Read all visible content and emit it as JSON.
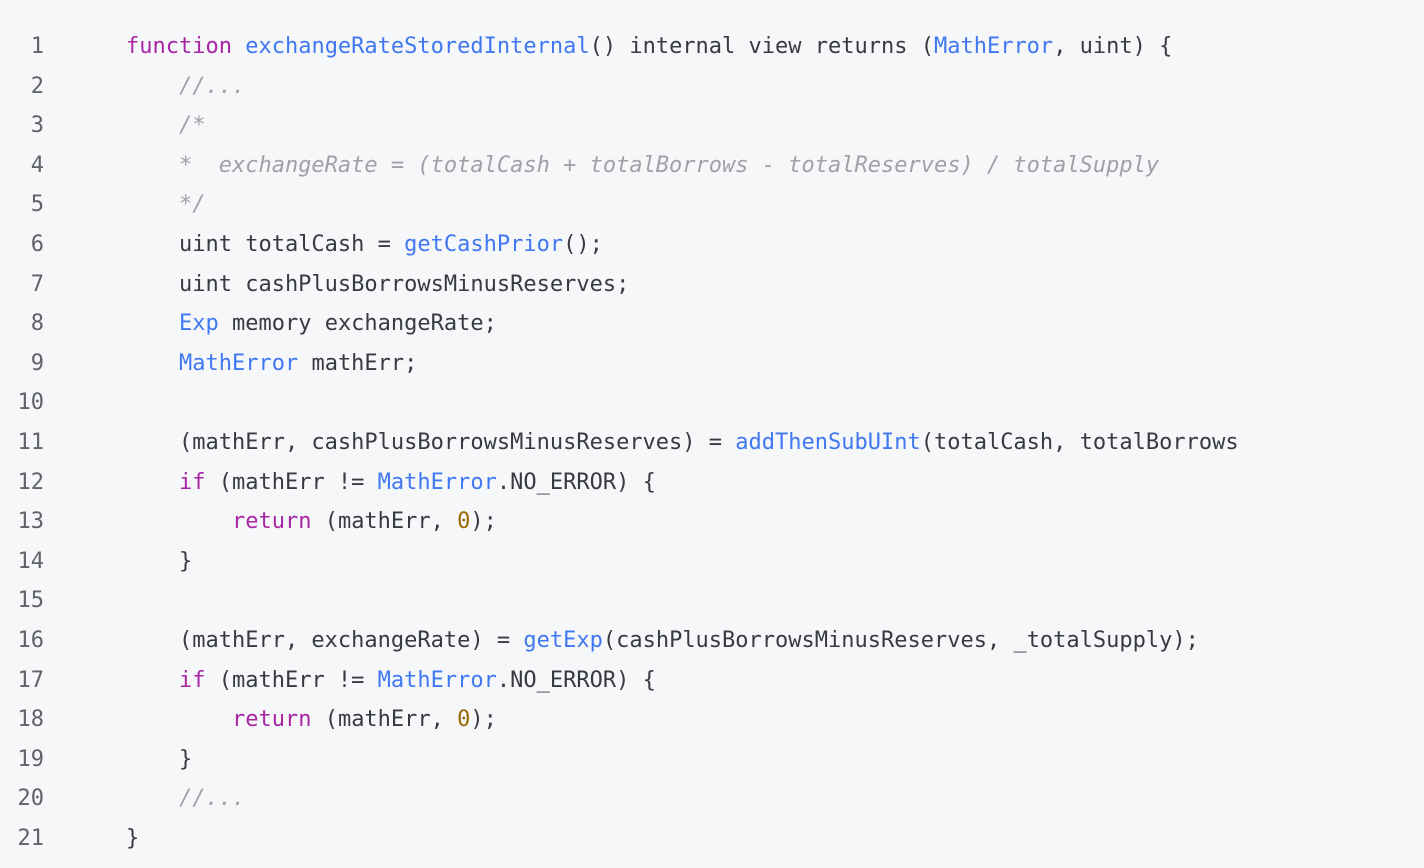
{
  "editor": {
    "language": "solidity",
    "lines": [
      {
        "n": "1",
        "tokens": [
          [
            "kw",
            "function"
          ],
          [
            "t",
            " "
          ],
          [
            "fn",
            "exchangeRateStoredInternal"
          ],
          [
            "t",
            "() internal view returns ("
          ],
          [
            "ty",
            "MathError"
          ],
          [
            "t",
            ", uint) {"
          ]
        ]
      },
      {
        "n": "2",
        "tokens": [
          [
            "t",
            "    "
          ],
          [
            "cm",
            "//..."
          ]
        ]
      },
      {
        "n": "3",
        "tokens": [
          [
            "t",
            "    "
          ],
          [
            "cm",
            "/*"
          ]
        ]
      },
      {
        "n": "4",
        "tokens": [
          [
            "t",
            "    "
          ],
          [
            "cm",
            "*  exchangeRate = (totalCash + totalBorrows - totalReserves) / totalSupply"
          ]
        ]
      },
      {
        "n": "5",
        "tokens": [
          [
            "t",
            "    "
          ],
          [
            "cm",
            "*/"
          ]
        ]
      },
      {
        "n": "6",
        "tokens": [
          [
            "t",
            "    uint totalCash = "
          ],
          [
            "fn",
            "getCashPrior"
          ],
          [
            "t",
            "();"
          ]
        ]
      },
      {
        "n": "7",
        "tokens": [
          [
            "t",
            "    uint cashPlusBorrowsMinusReserves;"
          ]
        ]
      },
      {
        "n": "8",
        "tokens": [
          [
            "t",
            "    "
          ],
          [
            "ty",
            "Exp"
          ],
          [
            "t",
            " memory exchangeRate;"
          ]
        ]
      },
      {
        "n": "9",
        "tokens": [
          [
            "t",
            "    "
          ],
          [
            "ty",
            "MathError"
          ],
          [
            "t",
            " mathErr;"
          ]
        ]
      },
      {
        "n": "10",
        "tokens": []
      },
      {
        "n": "11",
        "tokens": [
          [
            "t",
            "    (mathErr, cashPlusBorrowsMinusReserves) = "
          ],
          [
            "fn",
            "addThenSubUInt"
          ],
          [
            "t",
            "(totalCash, totalBorrows"
          ]
        ]
      },
      {
        "n": "12",
        "tokens": [
          [
            "t",
            "    "
          ],
          [
            "kw",
            "if"
          ],
          [
            "t",
            " (mathErr != "
          ],
          [
            "ty",
            "MathError"
          ],
          [
            "t",
            ".NO_ERROR) {"
          ]
        ]
      },
      {
        "n": "13",
        "tokens": [
          [
            "t",
            "        "
          ],
          [
            "kw",
            "return"
          ],
          [
            "t",
            " (mathErr, "
          ],
          [
            "num",
            "0"
          ],
          [
            "t",
            ");"
          ]
        ]
      },
      {
        "n": "14",
        "tokens": [
          [
            "t",
            "    }"
          ]
        ]
      },
      {
        "n": "15",
        "tokens": []
      },
      {
        "n": "16",
        "tokens": [
          [
            "t",
            "    (mathErr, exchangeRate) = "
          ],
          [
            "fn",
            "getExp"
          ],
          [
            "t",
            "(cashPlusBorrowsMinusReserves, _totalSupply);"
          ]
        ]
      },
      {
        "n": "17",
        "tokens": [
          [
            "t",
            "    "
          ],
          [
            "kw",
            "if"
          ],
          [
            "t",
            " (mathErr != "
          ],
          [
            "ty",
            "MathError"
          ],
          [
            "t",
            ".NO_ERROR) {"
          ]
        ]
      },
      {
        "n": "18",
        "tokens": [
          [
            "t",
            "        "
          ],
          [
            "kw",
            "return"
          ],
          [
            "t",
            " (mathErr, "
          ],
          [
            "num",
            "0"
          ],
          [
            "t",
            ");"
          ]
        ]
      },
      {
        "n": "19",
        "tokens": [
          [
            "t",
            "    }"
          ]
        ]
      },
      {
        "n": "20",
        "tokens": [
          [
            "t",
            "    "
          ],
          [
            "cm",
            "//..."
          ]
        ]
      },
      {
        "n": "21",
        "tokens": [
          [
            "t",
            "}"
          ]
        ]
      }
    ]
  },
  "colors": {
    "background": "#f6f7f9",
    "text": "#383a42",
    "keyword": "#a626a4",
    "function": "#4078f2",
    "number": "#986801",
    "comment": "#a0a1a7",
    "line_number": "#5f6268"
  }
}
